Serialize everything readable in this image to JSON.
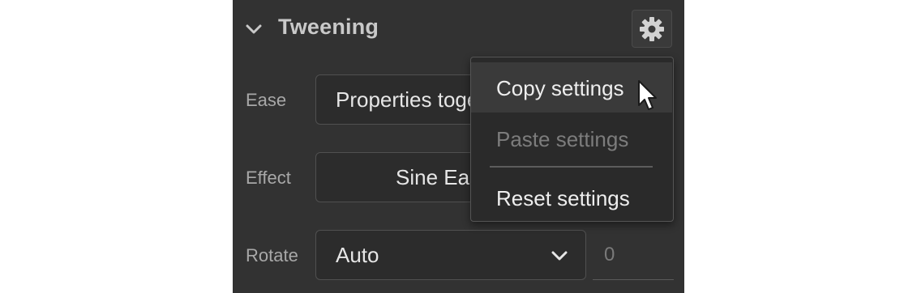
{
  "panel": {
    "title": "Tweening",
    "settings_icon": "gear-icon",
    "expand_icon": "chevron-down-icon"
  },
  "rows": {
    "ease": {
      "label": "Ease",
      "value": "Properties together"
    },
    "effect": {
      "label": "Effect",
      "value": "Sine Ease-In-Out"
    },
    "rotate": {
      "label": "Rotate",
      "value": "Auto",
      "count": "0"
    }
  },
  "menu": {
    "items": [
      {
        "label": "Copy settings",
        "state": "hover"
      },
      {
        "label": "Paste settings",
        "state": "disabled"
      },
      {
        "label": "Reset settings",
        "state": "normal"
      }
    ]
  },
  "colors": {
    "panel_bg": "#323232",
    "menu_bg": "#2a2a2a",
    "text_primary": "#eeeeee",
    "text_disabled": "#7c7c7c"
  }
}
